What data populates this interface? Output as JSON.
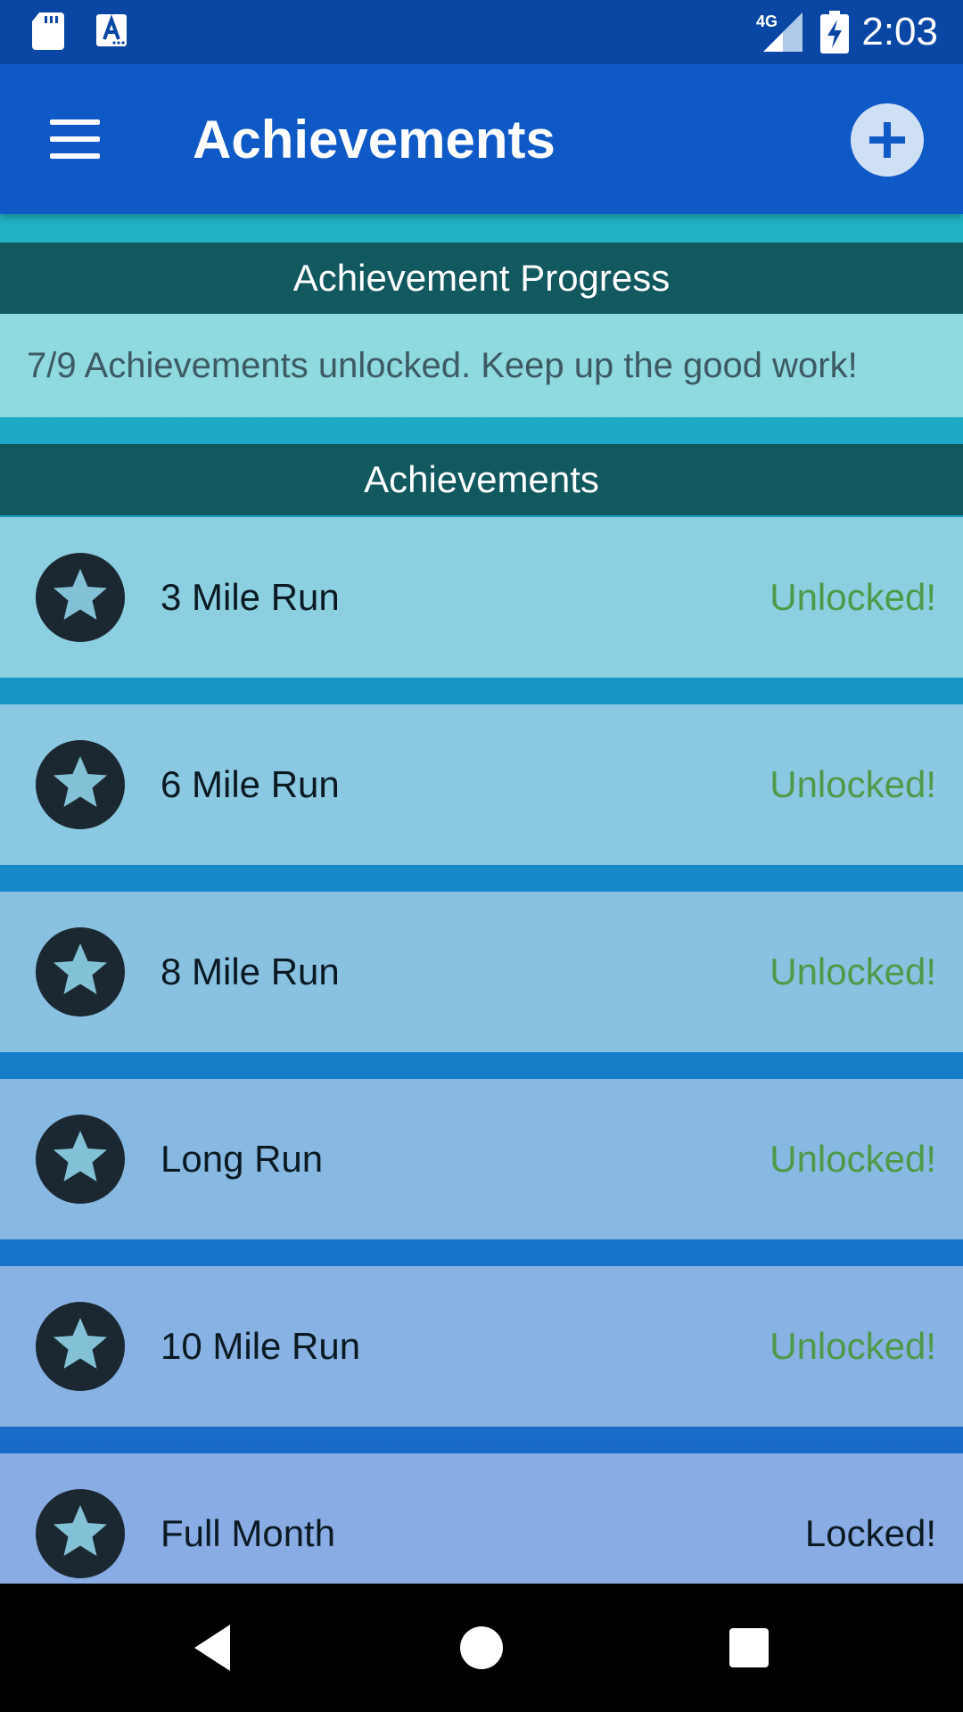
{
  "status_bar": {
    "time": "2:03",
    "network": "4G",
    "icons": [
      "sd-card-icon",
      "a-notification-icon",
      "signal-icon",
      "battery-charging-icon"
    ]
  },
  "app_bar": {
    "title": "Achievements",
    "menu_icon": "hamburger-menu-icon",
    "action_icon": "plus-icon"
  },
  "progress": {
    "header": "Achievement Progress",
    "text": "7/9 Achievements unlocked. Keep up the good work!"
  },
  "achievements": {
    "header": "Achievements",
    "items": [
      {
        "name": "3 Mile Run",
        "status": "Unlocked!"
      },
      {
        "name": "6 Mile Run",
        "status": "Unlocked!"
      },
      {
        "name": "8 Mile Run",
        "status": "Unlocked!"
      },
      {
        "name": "Long Run",
        "status": "Unlocked!"
      },
      {
        "name": "10 Mile Run",
        "status": "Unlocked!"
      },
      {
        "name": "Full Month",
        "status": "Locked!"
      }
    ]
  },
  "colors": {
    "status_bar": "#0a47a4",
    "app_bar": "#0f59c6",
    "section_header": "#11585f",
    "unlocked": "#4e9a49",
    "locked": "#0b1a22"
  },
  "nav_bar": {
    "icons": [
      "back-icon",
      "home-icon",
      "recents-icon"
    ]
  }
}
